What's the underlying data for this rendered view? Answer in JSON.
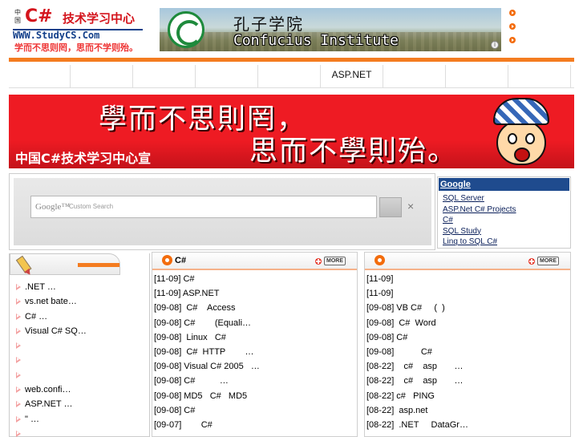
{
  "header": {
    "logo": {
      "small_text": "中国",
      "c_sharp": "C#",
      "title": "技术学习中心",
      "url": "WWW.StudyCS.Com",
      "motto": "学而不思则罔，思而不学则殆。"
    },
    "ad_banner": {
      "title_cn": "孔子学院",
      "title_en": "Confucius Institute",
      "info_glyph": "i"
    }
  },
  "nav": {
    "items": [
      "",
      "",
      "",
      "",
      "",
      "ASP.NET",
      "",
      "",
      ""
    ]
  },
  "hero": {
    "line1": "學而不思則罔，",
    "line2": "思而不學則殆。",
    "caption": "中国C#技术学习中心宣"
  },
  "search": {
    "brand": "Google™",
    "placeholder": "Custom Search",
    "clear_glyph": "×"
  },
  "links": {
    "title": "Google",
    "items": [
      "SQL Server",
      "ASP.Net C# Projects",
      "C#",
      "SQL Study",
      "Linq to SQL C#"
    ]
  },
  "left_list": {
    "items": [
      ".NET      …",
      "vs.net bate…",
      "C#        …",
      "Visual C# SQ…",
      "",
      "",
      "",
      "  web.confi…",
      "ASP.NET    …",
      "  \"        …",
      ""
    ]
  },
  "panel_csharp": {
    "title": "C#",
    "more_label": "MORE",
    "items": [
      "[11-09] C#",
      "[11-09] ASP.NET",
      "[09-08]  C#    Access",
      "[09-08] C#        (Equali…",
      "[09-08]  Linux   C#",
      "[09-08]  C#  HTTP        …",
      "[09-08] Visual C# 2005   …",
      "[09-08] C#          …",
      "[09-08] MD5   C#   MD5",
      "[09-08] C#",
      "[09-07]        C#"
    ]
  },
  "panel_right": {
    "title": "",
    "more_label": "MORE",
    "items": [
      "[11-09]",
      "[11-09]",
      "[09-08] VB C#     (  )",
      "[09-08]  C#  Word",
      "[09-08] C#",
      "[09-08]           C#",
      "[08-22]    c#    asp       …",
      "[08-22]    c#    asp       …",
      "[08-22] c#   PING",
      "[08-22]  asp.net",
      "[08-22]  .NET     DataGr…"
    ]
  },
  "colors": {
    "accent_orange": "#f47c20",
    "banner_red": "#ee1b23",
    "logo_red": "#d4141c",
    "link_blue": "#1f4b8e"
  }
}
